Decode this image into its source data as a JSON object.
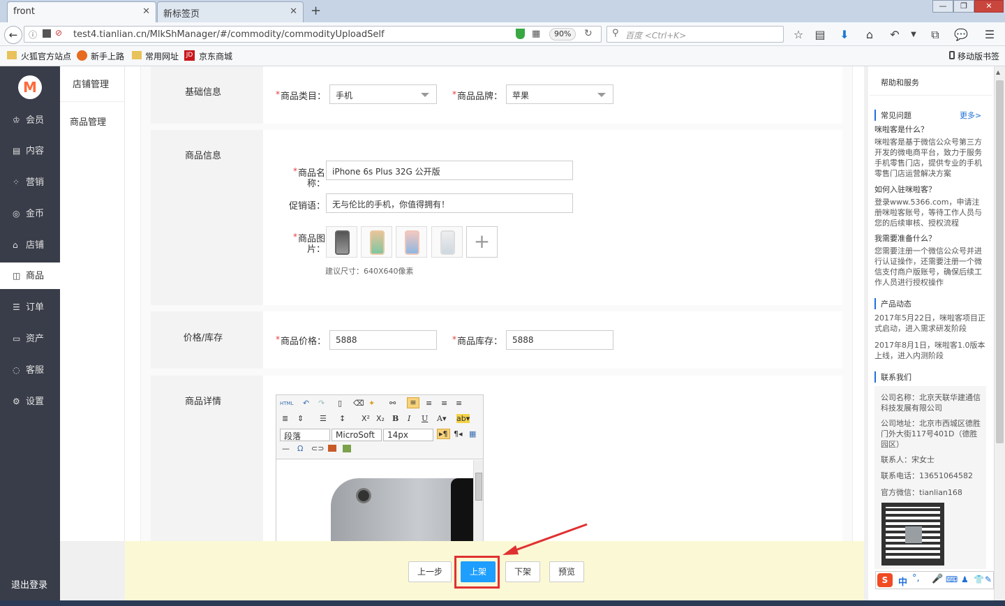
{
  "browser": {
    "tabs": [
      {
        "label": "front"
      },
      {
        "label": "新标签页"
      }
    ],
    "new_tab": "+",
    "url": "test4.tianlian.cn/MlkShManager/#/commodity/commodityUploadSelf",
    "zoom": "90%",
    "search_placeholder": "百度 <Ctrl+K>",
    "bookmarks": [
      "火狐官方站点",
      "新手上路",
      "常用网址",
      "京东商城"
    ],
    "mobile_bookmarks": "移动版书签"
  },
  "sidebar": {
    "logo": "M",
    "items": [
      {
        "label": "会员",
        "icon": "crown-icon"
      },
      {
        "label": "内容",
        "icon": "document-icon"
      },
      {
        "label": "营销",
        "icon": "grid-icon"
      },
      {
        "label": "金币",
        "icon": "coin-icon"
      },
      {
        "label": "店铺",
        "icon": "store-icon"
      },
      {
        "label": "商品",
        "icon": "bag-icon",
        "active": true
      },
      {
        "label": "订单",
        "icon": "list-icon"
      },
      {
        "label": "资产",
        "icon": "wallet-icon"
      },
      {
        "label": "客服",
        "icon": "chat-icon"
      },
      {
        "label": "设置",
        "icon": "gear-icon"
      }
    ],
    "logout": "退出登录"
  },
  "subnav": {
    "title": "店铺管理",
    "item": "商品管理"
  },
  "form": {
    "basic": {
      "section_label": "基础信息",
      "category_label": "商品类目：",
      "category_value": "手机",
      "brand_label": "商品品牌：",
      "brand_value": "苹果"
    },
    "info": {
      "section_label": "商品信息",
      "name_label_1": "商品名",
      "name_label_2": "称：",
      "name_value": "iPhone 6s Plus 32G 公开版",
      "promo_label": "促销语：",
      "promo_value": "无与伦比的手机，你值得拥有！",
      "image_label_1": "商品图",
      "image_label_2": "片：",
      "image_hint": "建议尺寸：640X640像素",
      "add_image": "+"
    },
    "price": {
      "section_label": "价格/库存",
      "price_label": "商品价格：",
      "price_value": "5888",
      "stock_label": "商品库存：",
      "stock_value": "5888"
    },
    "detail": {
      "section_label": "商品详情",
      "paragraph": "段落",
      "font": "MicroSoft",
      "size": "14px"
    },
    "required_mark": "*"
  },
  "buttons": {
    "prev": "上一步",
    "publish": "上架",
    "unpublish": "下架",
    "preview": "预览"
  },
  "help": {
    "title": "帮助和服务",
    "faq_title": "常见问题",
    "more": "更多>",
    "q1": "咪啦客是什么？",
    "a1": "咪啦客是基于微信公众号第三方开发的微电商平台，致力于服务手机零售门店，提供专业的手机零售门店运营解决方案",
    "q2": "如何入驻咪啦客？",
    "a2": "登录www.5366.com，申请注册咪啦客账号，等待工作人员与您的后续审核、授权流程",
    "q3": "我需要准备什么？",
    "a3": "您需要注册一个微信公众号并进行认证操作，还需要注册一个微信支付商户版账号，确保后续工作人员进行授权操作",
    "news_title": "产品动态",
    "news1": "2017年5月22日，咪啦客项目正式启动，进入需求研发阶段",
    "news2": "2017年8月1日，咪啦客1.0版本上线，进入内测阶段",
    "contact_title": "联系我们",
    "company": "公司名称：北京天联华建通信科技发展有限公司",
    "address": "公司地址：北京市西城区德胜门外大街117号401D（德胜园区）",
    "person": "联系人：宋女士",
    "phone": "联系电话：13651064582",
    "wechat": "官方微信：tianlian168"
  },
  "ime": {
    "logo": "S",
    "mode": "中"
  }
}
